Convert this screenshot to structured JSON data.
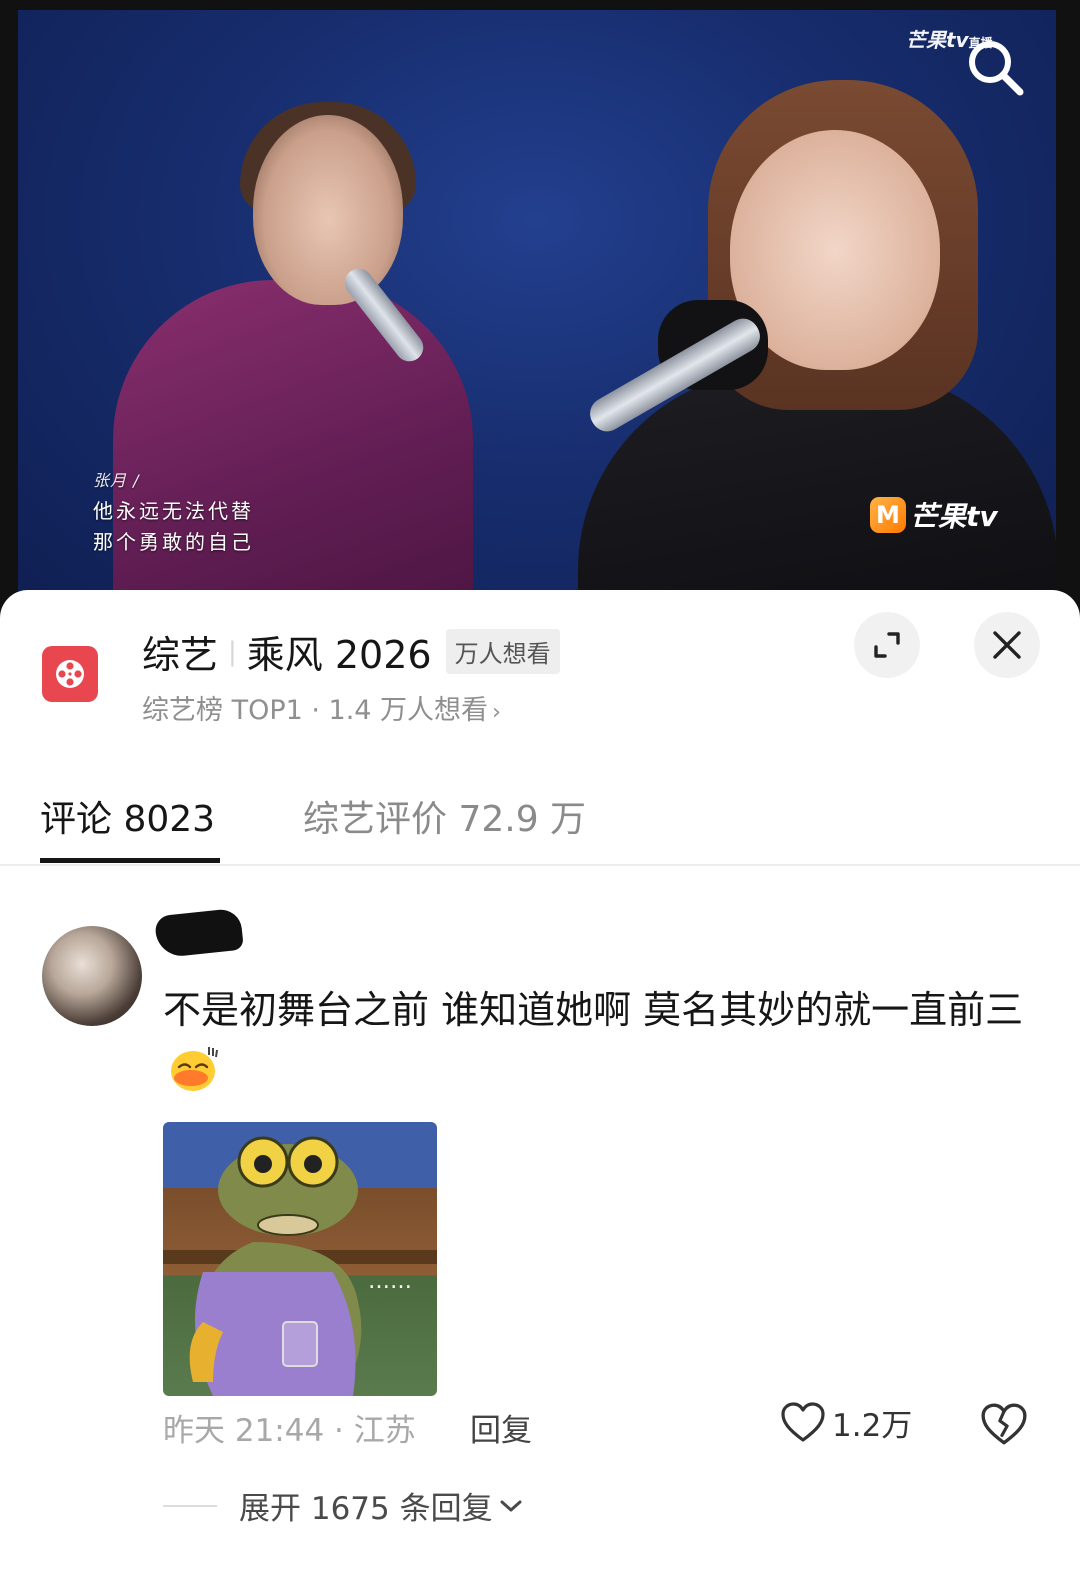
{
  "video": {
    "watermark_top": "芒果tv",
    "watermark_top_suffix": "直播",
    "lyric_credit": "张月 /",
    "lyric_line1": "他永远无法代替",
    "lyric_line2": "那个勇敢的自己",
    "brand_logo_letter": "M",
    "brand_logo_text": "芒果tv",
    "search_icon": "search-icon"
  },
  "show": {
    "category": "综艺",
    "title": "乘风 2026",
    "want_tag": "万人想看",
    "subtitle": "综艺榜 TOP1 · 1.4 万人想看",
    "icon": "film-reel-icon",
    "accent_color": "#e8474f"
  },
  "tabs": [
    {
      "label": "评论 8023",
      "active": true
    },
    {
      "label": "综艺评价 72.9 万",
      "active": false
    }
  ],
  "comment": {
    "text": "不是初舞台之前  谁知道她啊   莫名其妙的就一直前三",
    "emoji": "duck-emoji",
    "time_location": "昨天 21:44 · 江苏",
    "reply_label": "回复",
    "like_count": "1.2万",
    "meme_caption": "……",
    "expand_label": "展开 1675 条回复"
  }
}
